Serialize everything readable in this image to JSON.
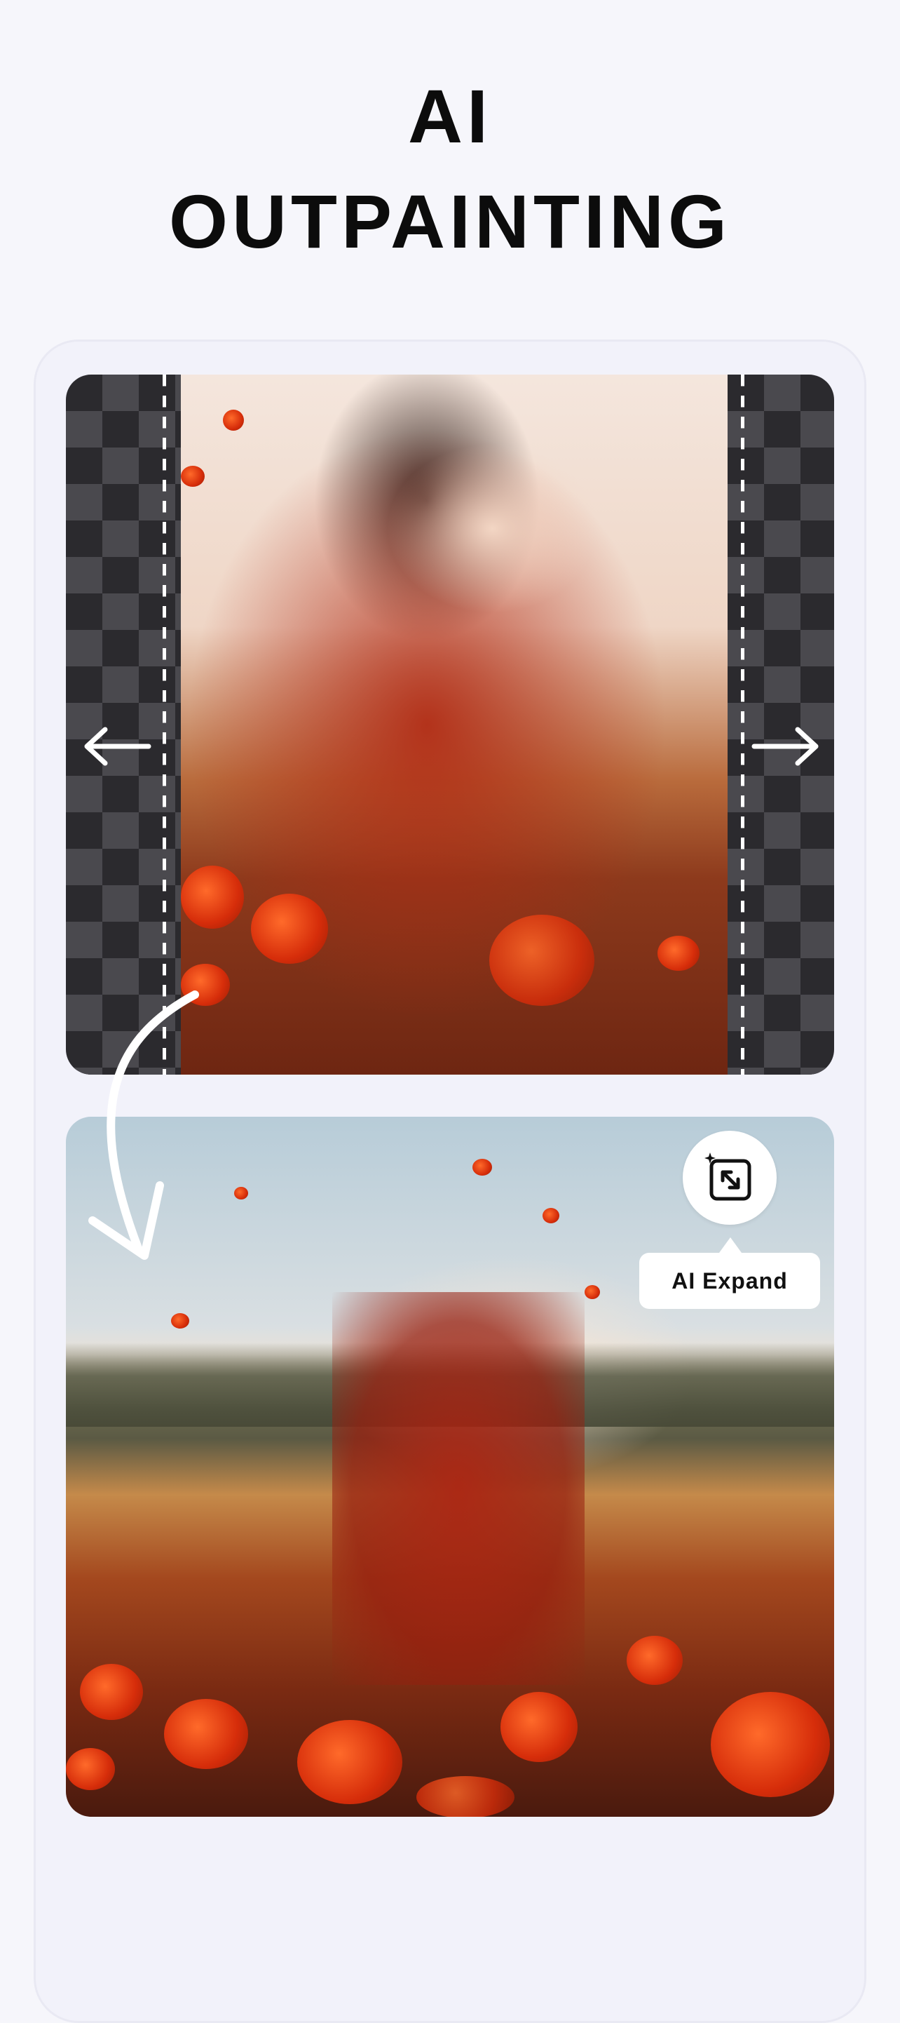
{
  "header": {
    "title_line1": "AI",
    "title_line2": "OUTPAINTING"
  },
  "before_panel": {
    "left_arrow_icon": "arrow-left-icon",
    "right_arrow_icon": "arrow-right-icon"
  },
  "after_panel": {
    "expand_icon": "ai-expand-icon",
    "expand_label": "AI Expand"
  },
  "colors": {
    "background": "#f6f6fb",
    "card": "#f2f2fa",
    "title": "#0c0c0c",
    "checker_dark": "#2b2a2e",
    "checker_light": "#4a494e"
  }
}
